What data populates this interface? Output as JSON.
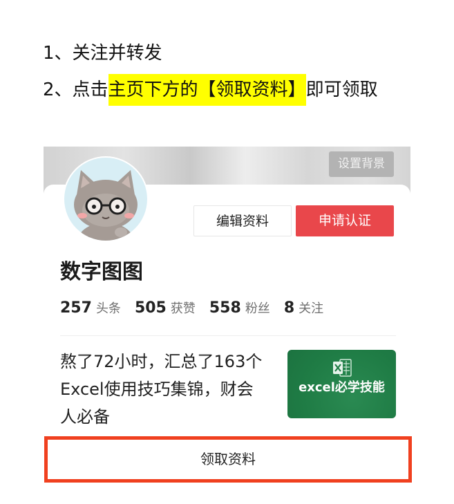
{
  "instructions": {
    "step1": "1、关注并转发",
    "step2_prefix": "2、点击",
    "step2_highlight": "主页下方的【领取资料】",
    "step2_suffix": "即可领取"
  },
  "profile": {
    "set_background_label": "设置背景",
    "avatar_icon": "cat-with-glasses-avatar",
    "edit_profile_label": "编辑资料",
    "apply_verify_label": "申请认证",
    "name": "数字图图",
    "stats": [
      {
        "value": "257",
        "label": "头条"
      },
      {
        "value": "505",
        "label": "获赞"
      },
      {
        "value": "558",
        "label": "粉丝"
      },
      {
        "value": "8",
        "label": "关注"
      }
    ]
  },
  "post": {
    "lines": [
      "熬了72小时，汇总了163个",
      "Excel使用技巧集锦，财会",
      "人必备"
    ],
    "thumbnail_icon": "excel-icon",
    "thumbnail_text": "excel必学技能"
  },
  "footer": {
    "claim_label": "领取资料"
  },
  "colors": {
    "highlight": "#ffff00",
    "verify_button": "#e9474b",
    "claim_border": "#f0401f",
    "thumbnail_bg": "#1f7c45"
  }
}
